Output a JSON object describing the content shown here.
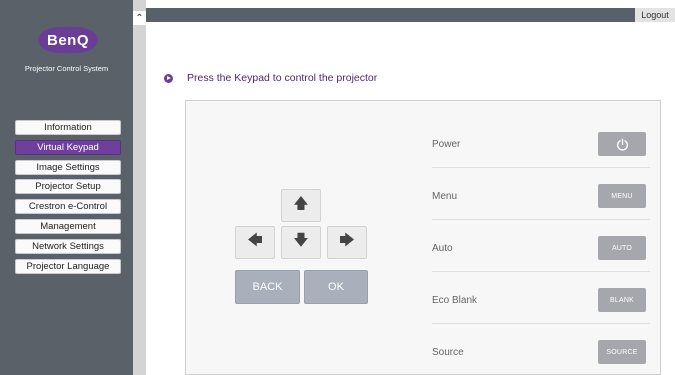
{
  "logo": {
    "text": "BenQ"
  },
  "sidebar": {
    "subtitle": "Projector Control System",
    "items": [
      {
        "label": "Information",
        "active": false
      },
      {
        "label": "Virtual Keypad",
        "active": true
      },
      {
        "label": "Image Settings",
        "active": false
      },
      {
        "label": "Projector Setup",
        "active": false
      },
      {
        "label": "Crestron e-Control",
        "active": false
      },
      {
        "label": "Management",
        "active": false
      },
      {
        "label": "Network Settings",
        "active": false
      },
      {
        "label": "Projector Language",
        "active": false
      }
    ]
  },
  "topbar": {
    "logout_label": "Logout"
  },
  "main": {
    "instruction": "Press the Keypad to control the projector"
  },
  "keypad": {
    "back_label": "BACK",
    "ok_label": "OK"
  },
  "functions": [
    {
      "label": "Power",
      "button": "power-icon"
    },
    {
      "label": "Menu",
      "button": "MENU"
    },
    {
      "label": "Auto",
      "button": "AUTO"
    },
    {
      "label": "Eco Blank",
      "button": "BLANK"
    },
    {
      "label": "Source",
      "button": "SOURCE"
    }
  ],
  "colors": {
    "brand": "#6b3d97",
    "sidebar": "#5a6169",
    "active_nav": "#6f3f9c",
    "key_button": "#a9afbb",
    "function_button": "#a5a7ac"
  }
}
